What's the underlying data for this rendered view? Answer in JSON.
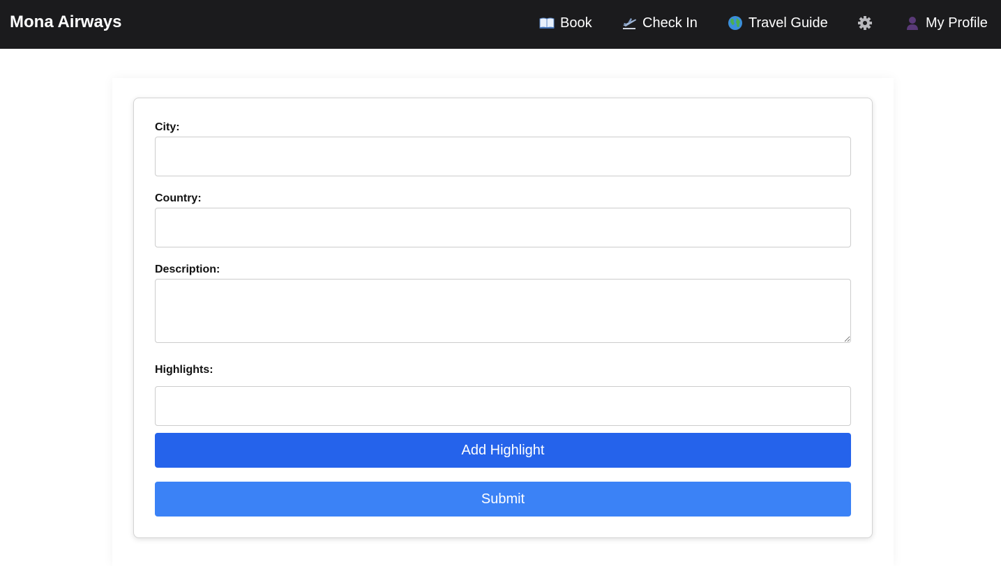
{
  "header": {
    "brand": "Mona Airways",
    "nav": {
      "book": {
        "label": "Book",
        "icon": "open-book-icon"
      },
      "check_in": {
        "label": "Check In",
        "icon": "airplane-departure-icon"
      },
      "travel_guide": {
        "label": "Travel Guide",
        "icon": "globe-icon"
      },
      "settings": {
        "icon": "gear-icon"
      },
      "profile": {
        "label": "My Profile",
        "icon": "user-silhouette-icon"
      }
    }
  },
  "form": {
    "city": {
      "label": "City:",
      "value": "",
      "placeholder": ""
    },
    "country": {
      "label": "Country:",
      "value": "",
      "placeholder": ""
    },
    "description": {
      "label": "Description:",
      "value": "",
      "placeholder": ""
    },
    "highlights": {
      "label": "Highlights:",
      "value": "",
      "placeholder": ""
    },
    "add_highlight_label": "Add Highlight",
    "submit_label": "Submit"
  },
  "colors": {
    "navbar_bg": "#1b1b1d",
    "add_button": "#2563eb",
    "submit_button": "#3b82f6"
  }
}
